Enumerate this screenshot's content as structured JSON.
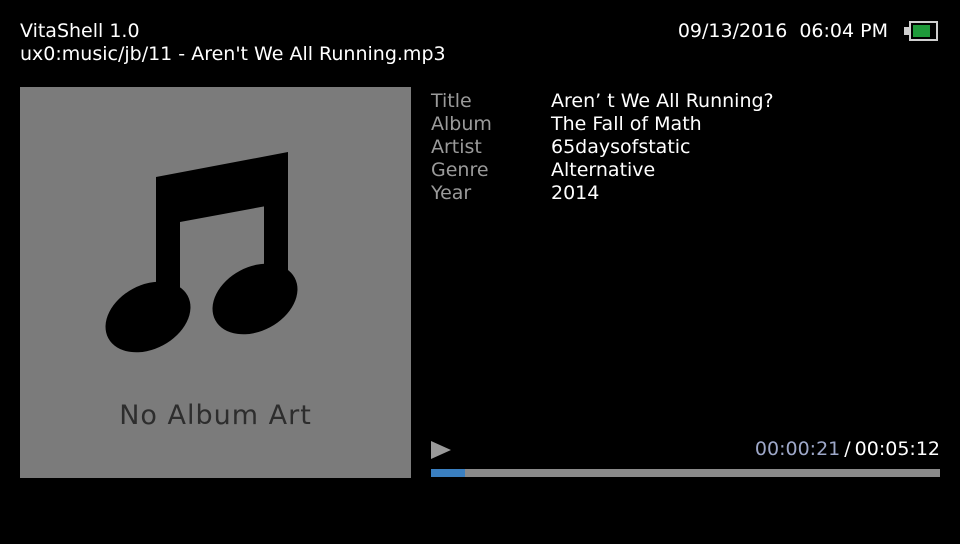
{
  "header": {
    "app_title": "VitaShell 1.0",
    "file_path": "ux0:music/jb/11 - Aren't We All Running.mp3",
    "date": "09/13/2016",
    "time": "06:04 PM",
    "battery_icon": "battery-icon",
    "battery_level": 0.85,
    "battery_color": "#1e9a3a"
  },
  "album_art": {
    "icon": "music-note-icon",
    "placeholder_label": "No Album Art",
    "background_color": "#7b7b7b"
  },
  "metadata": [
    {
      "key": "Title",
      "value": "Aren’ t We All Running?"
    },
    {
      "key": "Album",
      "value": "The Fall of Math"
    },
    {
      "key": "Artist",
      "value": "65daysofstatic"
    },
    {
      "key": "Genre",
      "value": "Alternative"
    },
    {
      "key": "Year",
      "value": "2014"
    }
  ],
  "player": {
    "state_icon": "play-icon",
    "elapsed": "00:00:21",
    "separator": "/",
    "total": "00:05:12",
    "progress": 0.0673,
    "progress_color": "#3a7fc0"
  }
}
